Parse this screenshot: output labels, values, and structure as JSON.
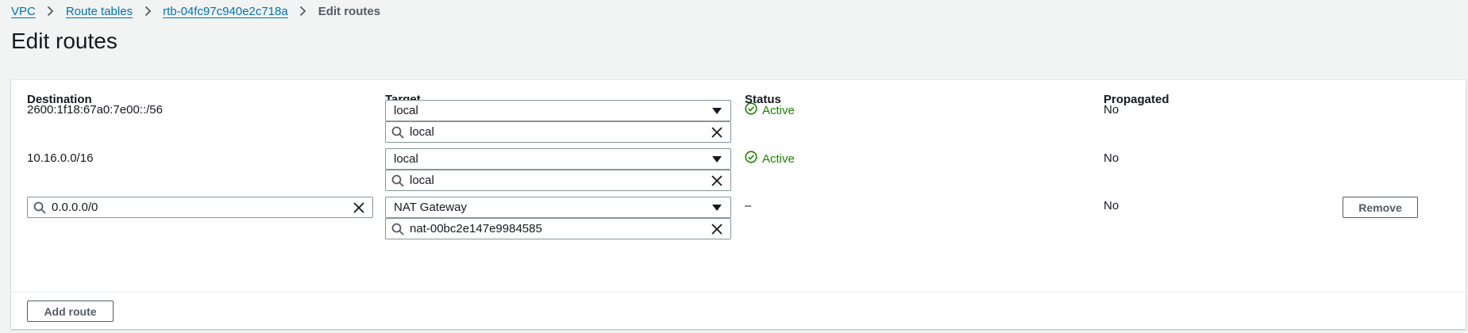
{
  "breadcrumb": {
    "items": [
      "VPC",
      "Route tables",
      "rtb-04fc97c940e2c718a"
    ],
    "current": "Edit routes"
  },
  "page_title": "Edit routes",
  "table": {
    "headers": {
      "destination": "Destination",
      "target": "Target",
      "status": "Status",
      "propagated": "Propagated"
    },
    "rows": [
      {
        "destination": "2600:1f18:67a0:7e00::/56",
        "target_type": "local",
        "target_value": "local",
        "status": "Active",
        "propagated": "No"
      },
      {
        "destination": "10.16.0.0/16",
        "target_type": "local",
        "target_value": "local",
        "status": "Active",
        "propagated": "No"
      },
      {
        "destination": "0.0.0.0/0",
        "target_type": "NAT Gateway",
        "target_value": "nat-00bc2e147e9984585",
        "status": "–",
        "propagated": "No",
        "remove_label": "Remove"
      }
    ]
  },
  "add_route_label": "Add route",
  "colors": {
    "link": "#0073bb",
    "status_active": "#1d8102",
    "background": "#f2f3f3",
    "border": "#879596"
  },
  "icons": {
    "breadcrumb_separator": "chevron-right-icon",
    "status": "check-circle-icon",
    "dropdown": "caret-down-icon",
    "search": "search-icon",
    "clear": "close-icon"
  }
}
